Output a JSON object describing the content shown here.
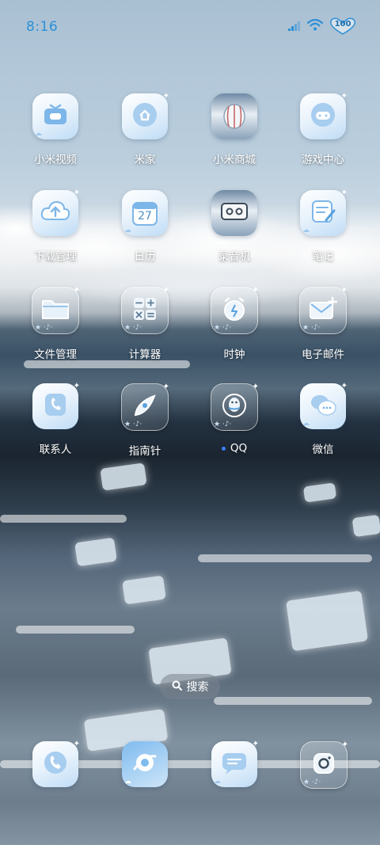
{
  "status_bar": {
    "time": "8:16",
    "battery_level": "100",
    "accent_color": "#2d8fd6"
  },
  "apps": [
    {
      "label": "小米视频",
      "icon": "video-icon"
    },
    {
      "label": "米家",
      "icon": "smart-home-icon"
    },
    {
      "label": "小米商城",
      "icon": "store-icon"
    },
    {
      "label": "游戏中心",
      "icon": "gamepad-icon"
    },
    {
      "label": "下载管理",
      "icon": "download-cloud-icon"
    },
    {
      "label": "日历",
      "icon": "calendar-icon",
      "calendar_day": "27"
    },
    {
      "label": "录音机",
      "icon": "recorder-icon"
    },
    {
      "label": "笔记",
      "icon": "notes-icon"
    },
    {
      "label": "文件管理",
      "icon": "folder-icon"
    },
    {
      "label": "计算器",
      "icon": "calculator-icon"
    },
    {
      "label": "时钟",
      "icon": "alarm-clock-icon"
    },
    {
      "label": "电子邮件",
      "icon": "mail-icon"
    },
    {
      "label": "联系人",
      "icon": "contacts-icon"
    },
    {
      "label": "指南针",
      "icon": "compass-icon"
    },
    {
      "label": "QQ",
      "icon": "qq-penguin-icon",
      "has_update_dot": true
    },
    {
      "label": "微信",
      "icon": "wechat-icon"
    }
  ],
  "search": {
    "label": "搜索"
  },
  "dock": [
    {
      "icon": "phone-icon"
    },
    {
      "icon": "browser-icon"
    },
    {
      "icon": "messages-icon"
    },
    {
      "icon": "camera-icon"
    }
  ]
}
